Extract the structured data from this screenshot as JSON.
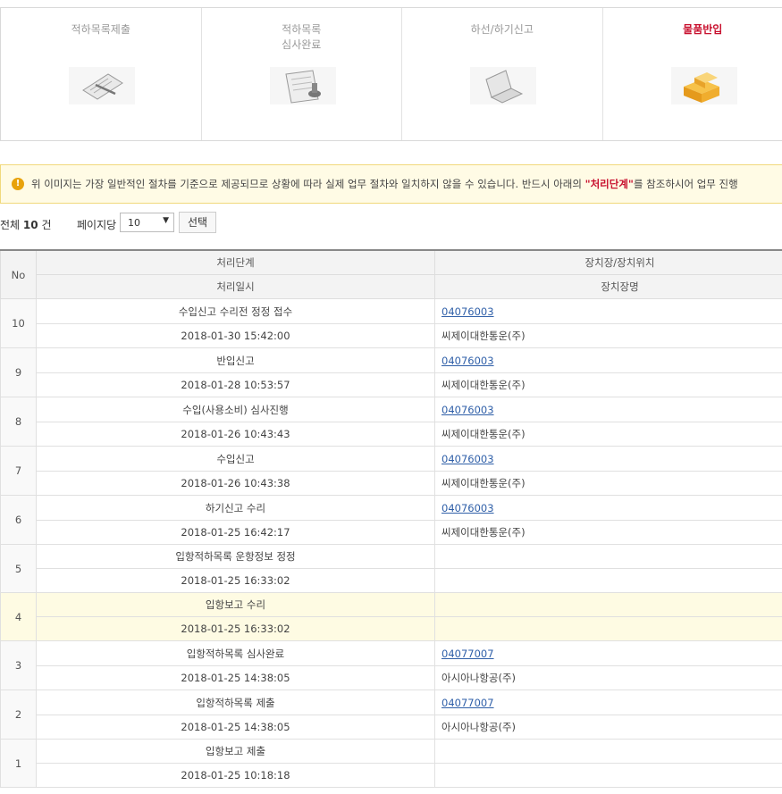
{
  "steps": [
    {
      "label": "적하목록제출",
      "icon": "clipboard-pen-icon",
      "active": false
    },
    {
      "label": "적하목록\n심사완료",
      "icon": "stamp-document-icon",
      "active": false
    },
    {
      "label": "하선/하기신고",
      "icon": "laptop-icon",
      "active": false
    },
    {
      "label": "물품반입",
      "icon": "boxes-icon",
      "active": true
    }
  ],
  "notice": {
    "prefix": "위 이미지는 가장 일반적인 절차를 기준으로 제공되므로 상황에 따라 실제 업무 절차와 일치하지 않을 수 있습니다. 반드시 아래의 ",
    "highlight": "\"처리단계\"",
    "suffix": "를 참조하시어 업무 진행"
  },
  "paging": {
    "total_label": "전체",
    "total_count": "10",
    "total_unit": "건",
    "per_page_label": "페이지당",
    "per_page_value": "10",
    "select_button": "선택"
  },
  "table": {
    "headers": {
      "no": "No",
      "step": "처리단계",
      "datetime": "처리일시",
      "location": "장치장/장치위치",
      "location_name": "장치장명"
    },
    "rows": [
      {
        "no": "10",
        "step": "수입신고 수리전 정정 접수",
        "datetime": "2018-01-30 15:42:00",
        "code": "04076003",
        "name": "씨제이대한통운(주)",
        "highlight": false
      },
      {
        "no": "9",
        "step": "반입신고",
        "datetime": "2018-01-28 10:53:57",
        "code": "04076003",
        "name": "씨제이대한통운(주)",
        "highlight": false
      },
      {
        "no": "8",
        "step": "수입(사용소비) 심사진행",
        "datetime": "2018-01-26 10:43:43",
        "code": "04076003",
        "name": "씨제이대한통운(주)",
        "highlight": false
      },
      {
        "no": "7",
        "step": "수입신고",
        "datetime": "2018-01-26 10:43:38",
        "code": "04076003",
        "name": "씨제이대한통운(주)",
        "highlight": false
      },
      {
        "no": "6",
        "step": "하기신고 수리",
        "datetime": "2018-01-25 16:42:17",
        "code": "04076003",
        "name": "씨제이대한통운(주)",
        "highlight": false
      },
      {
        "no": "5",
        "step": "입항적하목록 운항정보 정정",
        "datetime": "2018-01-25 16:33:02",
        "code": "",
        "name": "",
        "highlight": false
      },
      {
        "no": "4",
        "step": "입항보고 수리",
        "datetime": "2018-01-25 16:33:02",
        "code": "",
        "name": "",
        "highlight": true
      },
      {
        "no": "3",
        "step": "입항적하목록 심사완료",
        "datetime": "2018-01-25 14:38:05",
        "code": "04077007",
        "name": "아시아나항공(주)",
        "highlight": false
      },
      {
        "no": "2",
        "step": "입항적하목록 제출",
        "datetime": "2018-01-25 14:38:05",
        "code": "04077007",
        "name": "아시아나항공(주)",
        "highlight": false
      },
      {
        "no": "1",
        "step": "입항보고 제출",
        "datetime": "2018-01-25 10:18:18",
        "code": "",
        "name": "",
        "highlight": false
      }
    ]
  },
  "colors": {
    "active_step": "#c8102e",
    "link": "#2f5fa8",
    "notice_bg": "#fffbe5",
    "highlight_row": "#fefbe3"
  }
}
